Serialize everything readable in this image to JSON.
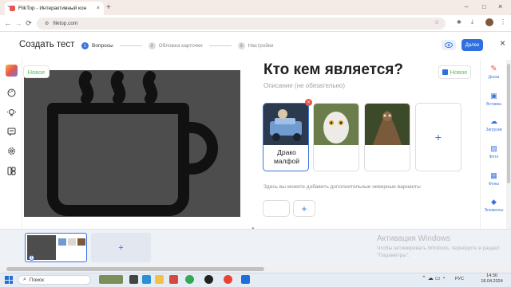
{
  "browser": {
    "tab_title": "FlikTop - Интерактивный кон",
    "tab_close": "×",
    "new_tab": "+",
    "url": "fliktop.com",
    "window_controls": [
      "–",
      "□",
      "×"
    ]
  },
  "header": {
    "title": "Создать тест",
    "steps": [
      {
        "num": "1",
        "label": "Вопросы"
      },
      {
        "num": "2",
        "label": "Обложка карточки"
      },
      {
        "num": "3",
        "label": "Настройки"
      }
    ],
    "next_label": "Далее"
  },
  "editor": {
    "new_badge": "Новое",
    "title": "Кто кем является?",
    "description_placeholder": "Описание (не обязательно)",
    "right_new_badge": "Новое",
    "card1_label": "Драко малфой",
    "delete_mark": "×",
    "add_symbol": "+",
    "hint": "Здесь вы можете добавить дополнительные неверные варианты"
  },
  "rightbar": {
    "items": [
      "Доска",
      "Вставка",
      "Загрузки",
      "Фото",
      "Фоны",
      "Элементы"
    ]
  },
  "thumbnails": {
    "first_num": "1",
    "add_symbol": "+"
  },
  "activation": {
    "title": "Активация Windows",
    "text": "Чтобы активировать Windows, перейдите в раздел \"Параметры\"."
  },
  "taskbar": {
    "search_label": "Поиск",
    "lang": "РУС",
    "time": "14:30",
    "date": "18.04.2024"
  }
}
